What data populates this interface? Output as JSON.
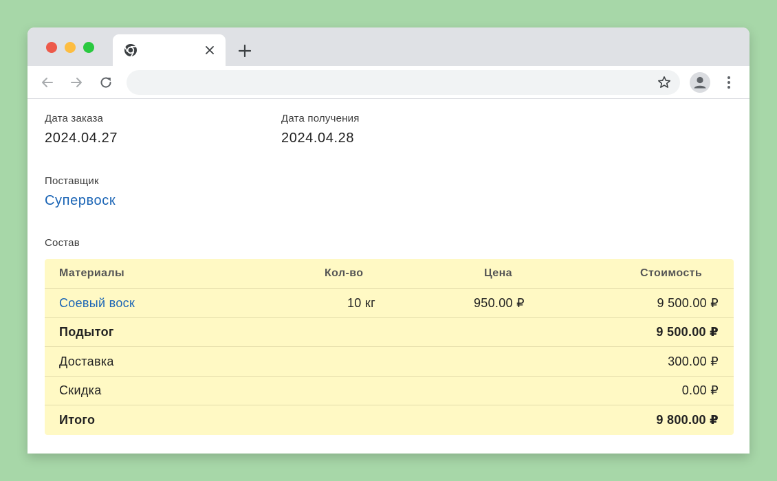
{
  "browser": {
    "tab": {
      "title": ""
    },
    "omnibox": {
      "url": ""
    }
  },
  "order": {
    "order_date_label": "Дата заказа",
    "order_date": "2024.04.27",
    "receive_date_label": "Дата получения",
    "receive_date": "2024.04.28",
    "supplier_label": "Поставщик",
    "supplier": "Супервоск",
    "composition_label": "Состав"
  },
  "table": {
    "headers": {
      "material": "Материалы",
      "qty": "Кол-во",
      "price": "Цена",
      "cost": "Стоимость"
    },
    "items": [
      {
        "material": "Соевый воск",
        "qty": "10 кг",
        "price": "950.00 ₽",
        "cost": "9 500.00 ₽"
      }
    ],
    "subtotal": {
      "label": "Подытог",
      "value": "9 500.00 ₽"
    },
    "delivery": {
      "label": "Доставка",
      "value": "300.00 ₽"
    },
    "discount": {
      "label": "Скидка",
      "value": "0.00 ₽"
    },
    "total": {
      "label": "Итого",
      "value": "9 800.00 ₽"
    }
  },
  "colors": {
    "background": "#a7d7a8",
    "table_background": "#fff9c4",
    "link": "#1a64b5",
    "close_red": "#ed594a",
    "minimize_yellow": "#fdbd41",
    "maximize_green": "#2ac940"
  },
  "icons": {
    "favicon": "chrome-icon",
    "tab_close": "close-icon",
    "new_tab": "plus-icon",
    "back": "arrow-left-icon",
    "forward": "arrow-right-icon",
    "reload": "reload-icon",
    "bookmark": "star-icon",
    "profile": "person-icon",
    "menu": "kebab-menu-icon"
  }
}
